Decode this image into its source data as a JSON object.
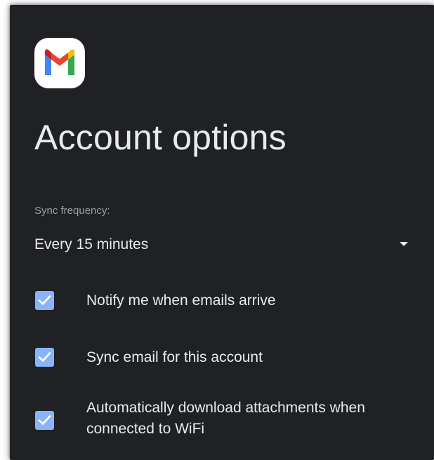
{
  "app": {
    "icon": "gmail-icon",
    "title": "Account options"
  },
  "sync": {
    "label": "Sync frequency:",
    "selected": "Every 15 minutes"
  },
  "options": [
    {
      "label": "Notify me when emails arrive",
      "checked": true
    },
    {
      "label": "Sync email for this account",
      "checked": true
    },
    {
      "label": "Automatically download attachments when connected to WiFi",
      "checked": true
    }
  ],
  "colors": {
    "background": "#202124",
    "checkbox": "#8ab4f8",
    "text": "#e8eaed",
    "muted_text": "#9aa0a6"
  }
}
